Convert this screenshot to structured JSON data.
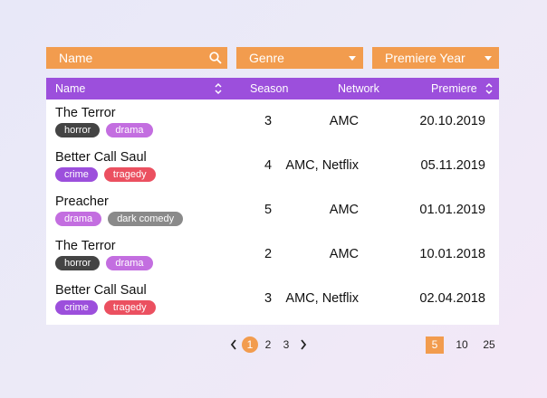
{
  "filters": {
    "name_placeholder": "Name",
    "genre_label": "Genre",
    "year_label": "Premiere Year"
  },
  "columns": {
    "name": "Name",
    "season": "Season",
    "network": "Network",
    "premiere": "Premiere"
  },
  "rows": [
    {
      "title": "The Terror",
      "tags": [
        "horror",
        "drama"
      ],
      "season": "3",
      "network": "AMC",
      "premiere": "20.10.2019"
    },
    {
      "title": "Better Call Saul",
      "tags": [
        "crime",
        "tragedy"
      ],
      "season": "4",
      "network": "AMC, Netflix",
      "premiere": "05.11.2019"
    },
    {
      "title": "Preacher",
      "tags": [
        "drama",
        "dark comedy"
      ],
      "season": "5",
      "network": "AMC",
      "premiere": "01.01.2019"
    },
    {
      "title": "The Terror",
      "tags": [
        "horror",
        "drama"
      ],
      "season": "2",
      "network": "AMC",
      "premiere": "10.01.2018"
    },
    {
      "title": "Better Call Saul",
      "tags": [
        "crime",
        "tragedy"
      ],
      "season": "3",
      "network": "AMC, Netflix",
      "premiere": "02.04.2018"
    }
  ],
  "tag_colors": {
    "horror": "#444444",
    "drama": "#c36ee0",
    "crime": "#9c4fdc",
    "tragedy": "#eb5060",
    "dark comedy": "#8a8a8a"
  },
  "pagination": {
    "pages": [
      "1",
      "2",
      "3"
    ],
    "current_page": "1",
    "page_sizes": [
      "5",
      "10",
      "25"
    ],
    "current_size": "5"
  },
  "colors": {
    "accent": "#f29c4e",
    "header": "#9c4fdc"
  }
}
